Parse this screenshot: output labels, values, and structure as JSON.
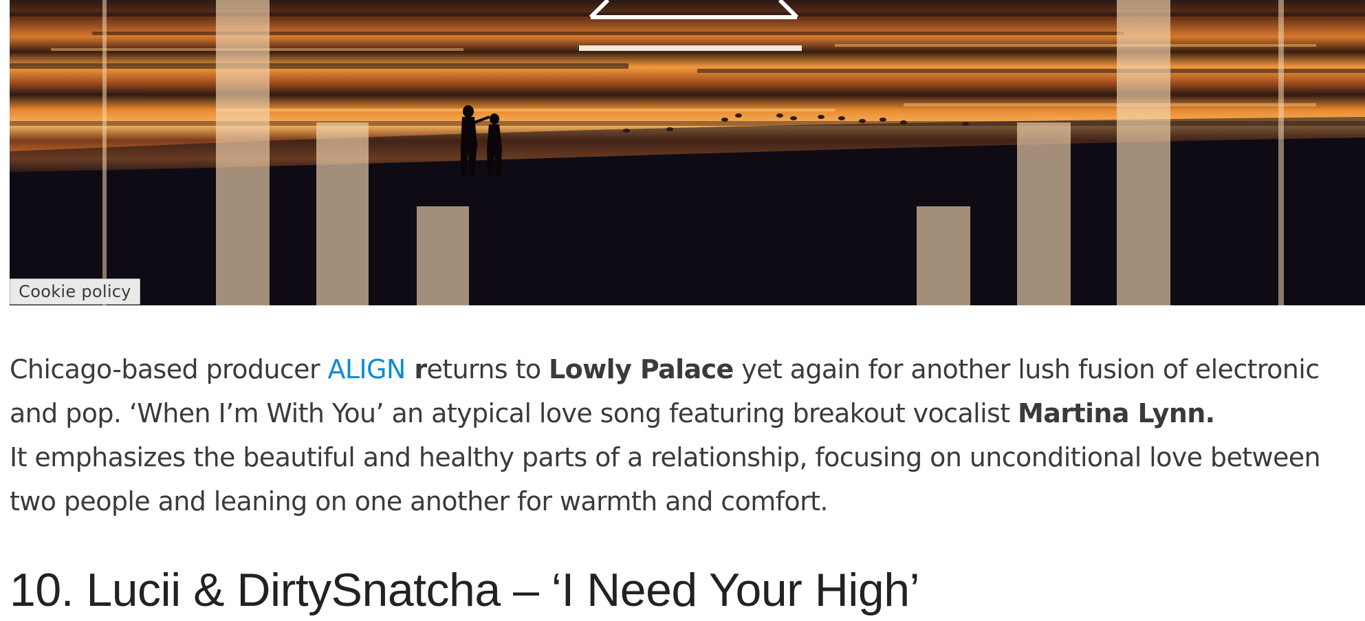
{
  "hero": {
    "image_name": "sunset-beach-couple-artwork"
  },
  "cookie": {
    "label": "Cookie policy"
  },
  "article": {
    "p1": {
      "t1": "Chicago-based producer ",
      "artist_link": "ALIGN",
      "t2": " r",
      "t3": "eturns to ",
      "label": "Lowly Palace",
      "t4": " yet again for another lush fusion of electronic and pop. ‘When I’m With You’ an atypical love song featuring breakout vocalist ",
      "vocalist": "Martina Lynn."
    },
    "p2": "It emphasizes the beautiful and healthy parts of a relationship, focusing on unconditional love between two people and leaning on one another for warmth and comfort."
  },
  "next_heading": "10. Lucii & DirtySnatcha – ‘I Need Your High’",
  "colors": {
    "link": "#0a8ad6",
    "text": "#3a3a3a",
    "heading": "#222222"
  }
}
